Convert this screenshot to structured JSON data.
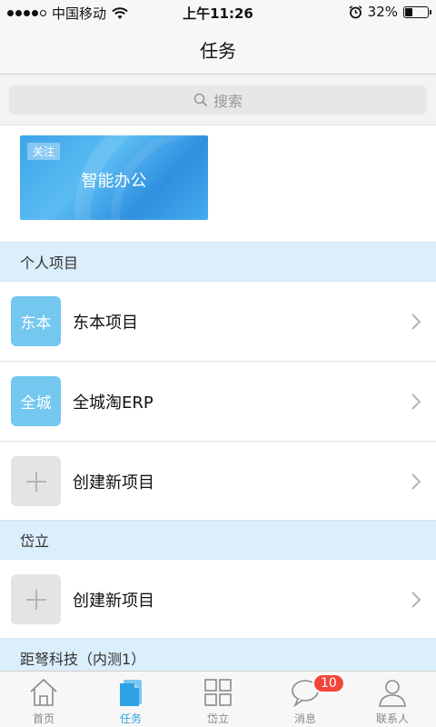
{
  "status_bar": {
    "carrier": "中国移动",
    "time": "上午11:26",
    "battery_percent": "32%",
    "battery_level": 0.32
  },
  "nav": {
    "title": "任务"
  },
  "search": {
    "placeholder": "搜索"
  },
  "banner": {
    "badge": "关注",
    "title": "智能办公"
  },
  "sections": [
    {
      "header": "个人项目",
      "items": [
        {
          "avatar_text": "东本",
          "label": "东本项目",
          "avatar_type": "blue"
        },
        {
          "avatar_text": "全城",
          "label": "全城淘ERP",
          "avatar_type": "blue"
        },
        {
          "avatar_text": "",
          "label": "创建新项目",
          "avatar_type": "plus"
        }
      ]
    },
    {
      "header": "岱立",
      "items": [
        {
          "avatar_text": "",
          "label": "创建新项目",
          "avatar_type": "plus"
        }
      ]
    },
    {
      "header": "距弩科技（内测1）",
      "items": []
    }
  ],
  "tab_bar": {
    "tabs": [
      {
        "label": "首页",
        "icon": "home-icon",
        "active": false
      },
      {
        "label": "任务",
        "icon": "task-icon",
        "active": true
      },
      {
        "label": "岱立",
        "icon": "grid-icon",
        "active": false
      },
      {
        "label": "消息",
        "icon": "message-icon",
        "active": false,
        "badge": "10"
      },
      {
        "label": "联系人",
        "icon": "contacts-icon",
        "active": false
      }
    ]
  },
  "colors": {
    "accent": "#2ea2e6",
    "section_bg": "#dbeefb",
    "avatar_blue": "#74c7ef",
    "badge_red": "#f0453b"
  }
}
